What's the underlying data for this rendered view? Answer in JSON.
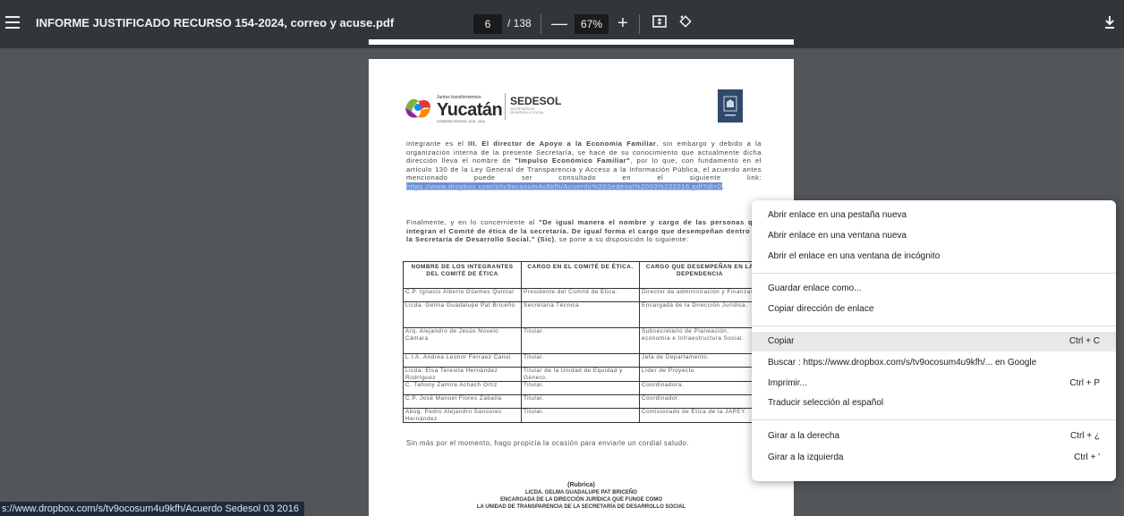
{
  "toolbar": {
    "title": "INFORME JUSTIFICADO RECURSO 154-2024, correo y acuse.pdf",
    "page_current": "6",
    "page_total": "/ 138",
    "zoom": "67%",
    "zoom_out": "—",
    "zoom_in": "+"
  },
  "document": {
    "header": {
      "logo_small": "Juntos transformemos",
      "logo_big": "Yucatán",
      "logo_gov": "GOBIERNO ESTATAL 2018 - 2024",
      "sedesol": "SEDESOL",
      "sedesol_sub": "SECRETARÍA DE DESARROLLO SOCIAL"
    },
    "para1_a": "integrante es el ",
    "para1_b": "III. El director de Apoyo a la Economía Familiar",
    "para1_c": ", sin embargo y debido a la organización interna de la presente Secretaría, se hace de su conocimiento que actualmente dicha dirección lleva el nombre de ",
    "para1_d": "\"Impulso Económico Familiar\"",
    "para1_e": ", por lo que, con fundamento en el artículo 130 de la Ley General de Transparencia y Acceso a la Información Pública, el acuerdo antes mencionado puede ser consultado en el siguiente link: ",
    "para1_link": "https://www.dropbox.com/s/tv9ocosum4u9kfh/Acuerdo%20Sedesol%2003%202016.pdf?dl=0",
    "para1_end": ".",
    "para2_a": "Finalmente, y en lo concerniente al ",
    "para2_b": "\"De igual manera el nombre y cargo de las personas que integran el Comité de ética de la secretaría. De igual forma el cargo que desempeñan dentro de la Secretaría de Desarrollo Social.\" (Sic)",
    "para2_c": ", se pone a su disposición lo siguiente:",
    "table": {
      "headers": [
        "NOMBRE DE LOS INTEGRANTES DEL COMITÉ DE ÉTICA",
        "CARGO EN EL COMITÉ DE ÉTICA.",
        "CARGO QUE DESEMPEÑAN EN LA DEPENDENCIA"
      ],
      "rows": [
        [
          "C.P. Ignacio Alberto Güemes Quintal",
          "Presidente del Comité de Ética.",
          "Director de administración y Finanzas."
        ],
        [
          "Licda. Gelma Guadalupe Pat Briceño",
          "Secretaria Técnica",
          "Encargada de la Dirección Jurídica."
        ],
        [
          "Arq. Alejandro de Jesús Novelo Cámara",
          "Titular.",
          "Subsecretario de Planeación, economía e Infraestructura Social."
        ],
        [
          "L.I.A. Andrea Leonor Ferraez Canul",
          "Titular.",
          "Jefa de Departamento."
        ],
        [
          "Licda. Elsa Teresita Hernández Rodríguez",
          "Titular de la Unidad de Equidad y Género.",
          "Líder de Proyecto"
        ],
        [
          "C. Tahony Zamira Achach Ortiz",
          "Titular.",
          "Coordinadora."
        ],
        [
          "C.P. José Manuel Flores Zaballa",
          "Titular.",
          "Coordinador."
        ],
        [
          "Abog. Pedro Alejandro Sansores Hernández",
          "Titular.",
          "Comisionado de Ética de la JAPEY."
        ]
      ]
    },
    "closing": "Sin más por el momento, hago propicia la ocasión para enviarle un cordial saludo.",
    "sig_rubrica": "(Rubrica)",
    "sig_name": "LICDA. GELMA GUADALUPE PAT BRICEÑO",
    "sig_line1": "ENCARGADA DE LA DIRECCIÓN JURÍDICA QUE FUNGE COMO",
    "sig_line2": "LA UNIDAD DE TRANSPARENCIA DE LA SECRETARÍA DE DESARROLLO SOCIAL"
  },
  "status_url": "s://www.dropbox.com/s/tv9ocosum4u9kfh/Acuerdo Sedesol 03 2016",
  "context_menu": {
    "items": [
      {
        "label": "Abrir enlace en una pestaña nueva",
        "shortcut": ""
      },
      {
        "label": "Abrir enlace en una ventana nueva",
        "shortcut": ""
      },
      {
        "label": "Abrir el enlace en una ventana de incógnito",
        "shortcut": ""
      },
      {
        "label": "Guardar enlace como...",
        "shortcut": ""
      },
      {
        "label": "Copiar dirección de enlace",
        "shortcut": ""
      },
      {
        "label": "Copiar",
        "shortcut": "Ctrl + C"
      },
      {
        "label": "Buscar : https://www.dropbox.com/s/tv9ocosum4u9kfh/... en Google",
        "shortcut": ""
      },
      {
        "label": "Imprimir...",
        "shortcut": "Ctrl + P"
      },
      {
        "label": "Traducir selección al español",
        "shortcut": ""
      },
      {
        "label": "Girar a la derecha",
        "shortcut": "Ctrl + ¿"
      },
      {
        "label": "Girar a la izquierda",
        "shortcut": "Ctrl + '"
      }
    ]
  },
  "colors": {
    "toolbar_bg": "#323639",
    "viewer_bg": "#525659",
    "link_selection": "#6b8fd6",
    "menu_hover": "#e8e8e8"
  }
}
